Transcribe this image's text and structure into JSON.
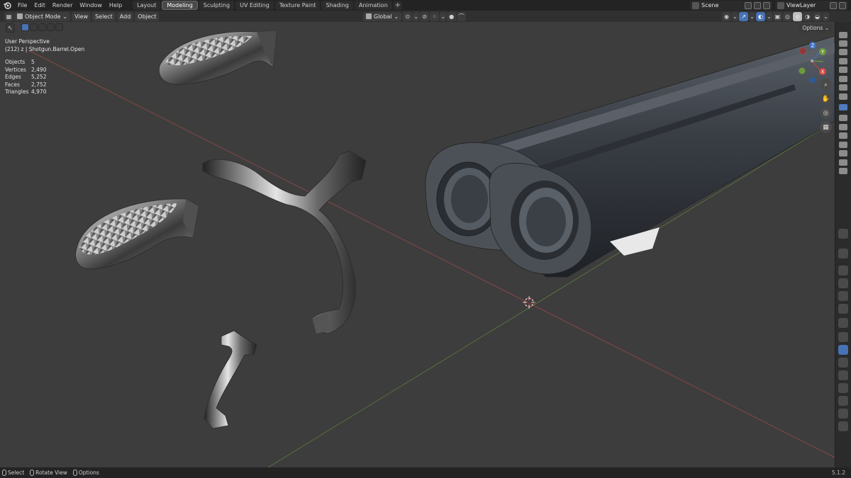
{
  "menu": {
    "file": "File",
    "edit": "Edit",
    "render": "Render",
    "window": "Window",
    "help": "Help"
  },
  "workspaces": [
    "Layout",
    "Modeling",
    "Sculpting",
    "UV Editing",
    "Texture Paint",
    "Shading",
    "Animation"
  ],
  "active_workspace": "Modeling",
  "add_workspace": "+",
  "scene": {
    "name": "Scene"
  },
  "view_layer": {
    "name": "ViewLayer"
  },
  "header": {
    "mode": "Object Mode",
    "view": "View",
    "select": "Select",
    "add": "Add",
    "object": "Object",
    "orientation": "Global",
    "options": "Options"
  },
  "viewport": {
    "perspective": "User Perspective",
    "collection_path": "(212) z | Shotgun.Barrel.Open",
    "stats": [
      {
        "label": "Objects",
        "value": "5"
      },
      {
        "label": "Vertices",
        "value": "2,490"
      },
      {
        "label": "Edges",
        "value": "5,252"
      },
      {
        "label": "Faces",
        "value": "2,752"
      },
      {
        "label": "Triangles",
        "value": "4,970"
      }
    ],
    "gizmo_axes": {
      "x": "X",
      "y": "Y",
      "z": "Z"
    }
  },
  "statusbar": {
    "select": "Select",
    "rotate": "Rotate View",
    "options": "Options",
    "version": "5.1.2"
  },
  "colors": {
    "accent": "#4772b3",
    "viewport_bg": "#3d3d3d",
    "axis_x": "#b0443f",
    "axis_y": "#5b8a3a",
    "axis_z": "#3f6fc0"
  }
}
